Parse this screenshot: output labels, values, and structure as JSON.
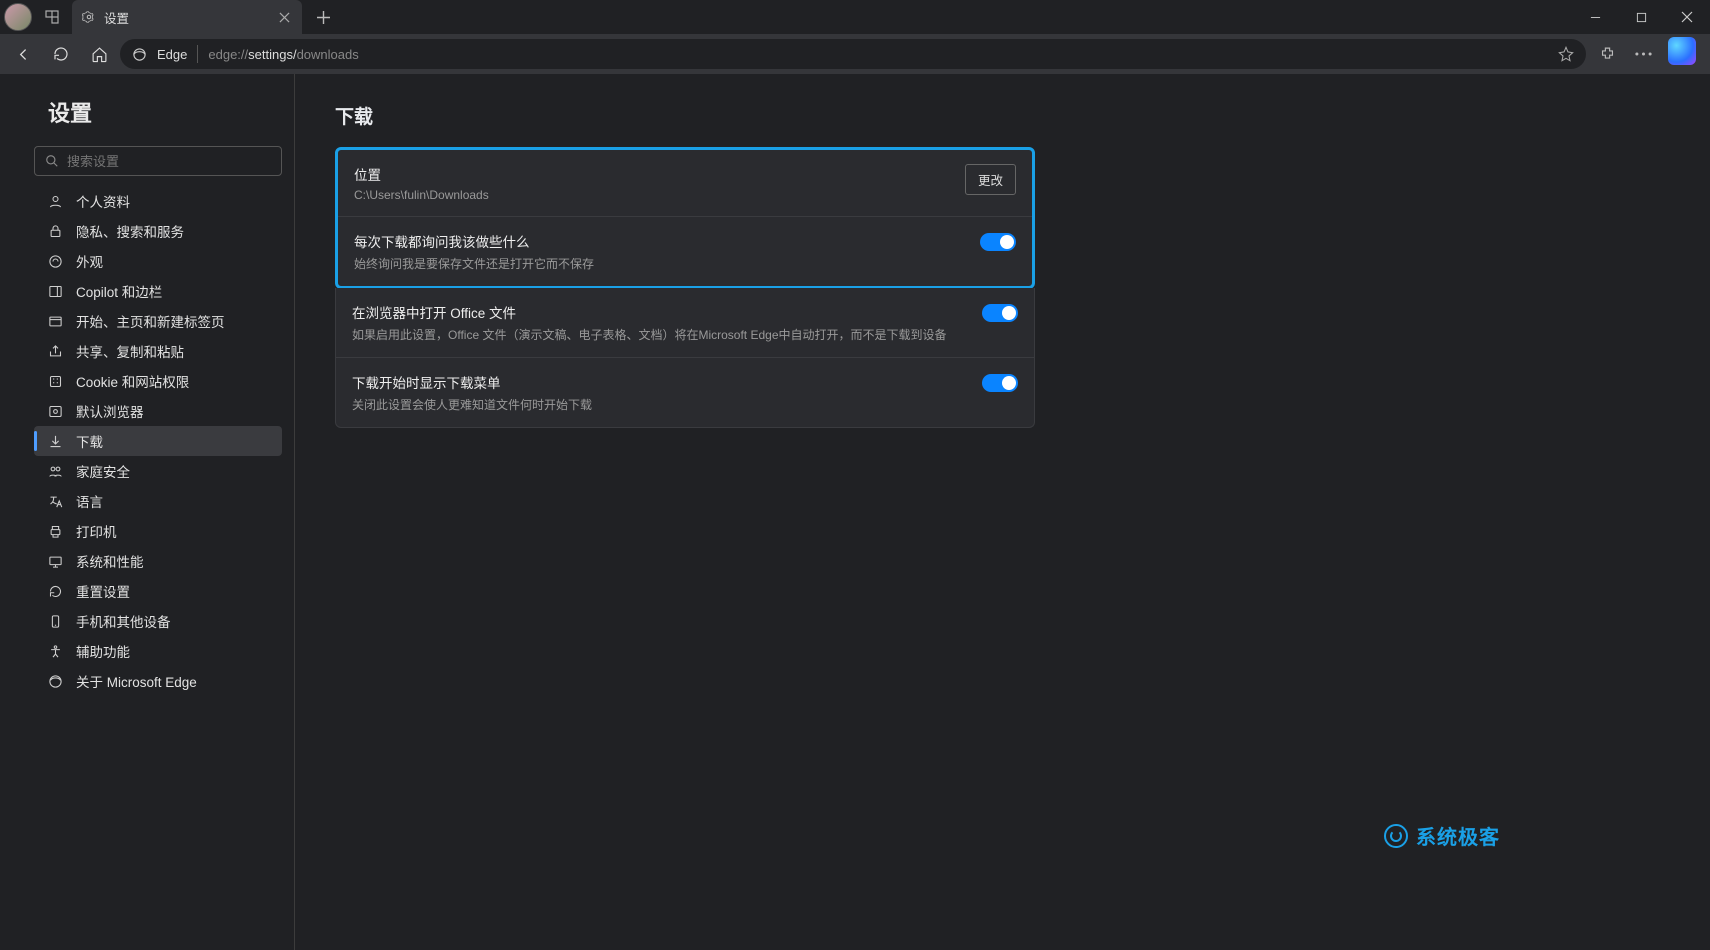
{
  "tab": {
    "title": "设置"
  },
  "address": {
    "badge": "Edge",
    "prefix": "edge://",
    "middle": "settings/",
    "suffix": "downloads"
  },
  "page": {
    "title": "设置"
  },
  "search": {
    "placeholder": "搜索设置"
  },
  "sidebar": {
    "items": [
      {
        "label": "个人资料"
      },
      {
        "label": "隐私、搜索和服务"
      },
      {
        "label": "外观"
      },
      {
        "label": "Copilot 和边栏"
      },
      {
        "label": "开始、主页和新建标签页"
      },
      {
        "label": "共享、复制和粘贴"
      },
      {
        "label": "Cookie 和网站权限"
      },
      {
        "label": "默认浏览器"
      },
      {
        "label": "下载"
      },
      {
        "label": "家庭安全"
      },
      {
        "label": "语言"
      },
      {
        "label": "打印机"
      },
      {
        "label": "系统和性能"
      },
      {
        "label": "重置设置"
      },
      {
        "label": "手机和其他设备"
      },
      {
        "label": "辅助功能"
      },
      {
        "label": "关于 Microsoft Edge"
      }
    ]
  },
  "content": {
    "heading": "下载",
    "location": {
      "title": "位置",
      "path": "C:\\Users\\fulin\\Downloads",
      "button": "更改"
    },
    "askEachTime": {
      "title": "每次下载都询问我该做些什么",
      "desc": "始终询问我是要保存文件还是打开它而不保存",
      "on": true
    },
    "openOffice": {
      "title": "在浏览器中打开 Office 文件",
      "desc": "如果启用此设置，Office 文件（演示文稿、电子表格、文档）将在Microsoft Edge中自动打开，而不是下载到设备",
      "on": true
    },
    "showMenu": {
      "title": "下载开始时显示下载菜单",
      "desc": "关闭此设置会使人更难知道文件何时开始下载",
      "on": true
    }
  },
  "watermark": "系统极客"
}
